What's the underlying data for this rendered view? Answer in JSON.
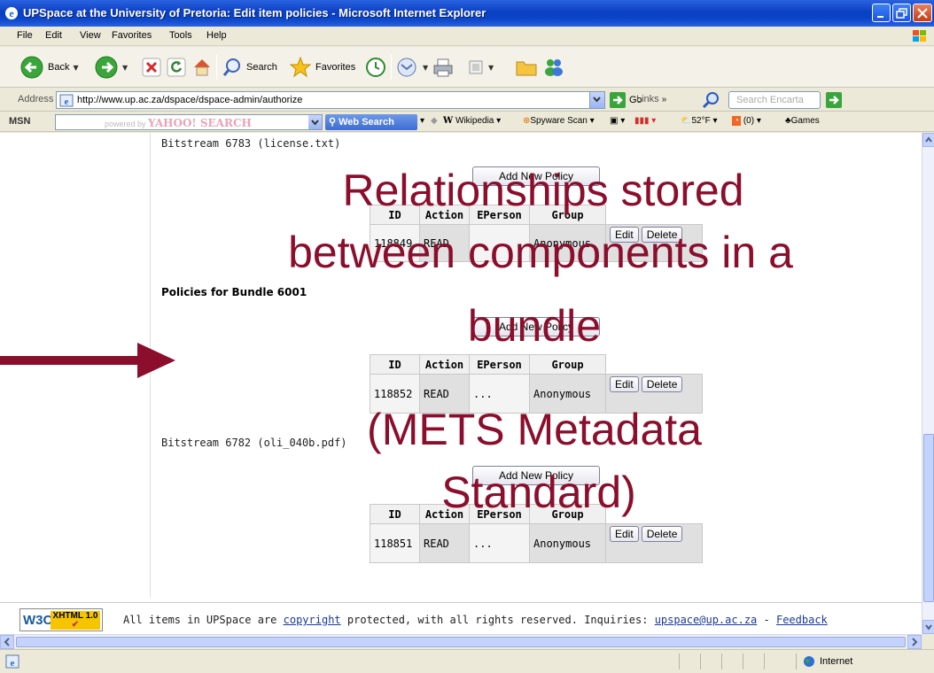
{
  "window": {
    "title": "UPSpace at the University of Pretoria: Edit item policies - Microsoft Internet Explorer"
  },
  "menu": [
    "File",
    "Edit",
    "View",
    "Favorites",
    "Tools",
    "Help"
  ],
  "toolbar": {
    "back": "Back",
    "search": "Search",
    "favorites": "Favorites"
  },
  "address": {
    "label": "Address",
    "url": "http://www.up.ac.za/dspace/dspace-admin/authorize",
    "go": "Go",
    "links": "Links",
    "encarta_placeholder": "Search Encarta"
  },
  "searchbar": {
    "msn": "MSN",
    "powered_by": "powered by",
    "yahoo": "YAHOO! SEARCH",
    "web_search": "Web Search",
    "wikipedia": "Wikipedia",
    "spyware": "Spyware Scan",
    "weather": "52°F",
    "rss": "(0)",
    "games": "Games"
  },
  "content": {
    "bitstream_license": "Bitstream 6783 (license.txt)",
    "policies_bundle": "Policies for Bundle 6001",
    "bitstream_pdf": "Bitstream 6782 (oli_040b.pdf)",
    "add_policy": "Add New Policy",
    "columns": [
      "ID",
      "Action",
      "EPerson",
      "Group"
    ],
    "edit": "Edit",
    "delete": "Delete",
    "rows": [
      {
        "id": "118849",
        "action": "READ",
        "eperson": "",
        "group": "Anonymous"
      },
      {
        "id": "118852",
        "action": "READ",
        "eperson": "...",
        "group": "Anonymous"
      },
      {
        "id": "118851",
        "action": "READ",
        "eperson": "...",
        "group": "Anonymous"
      }
    ]
  },
  "footer": {
    "w3c": "W3C",
    "xhtml": "XHTML 1.0",
    "text_1": "All items in UPSpace are",
    "copyright": "copyright",
    "text_2": "protected, with all rights reserved. Inquiries:",
    "email": "upspace@up.ac.za",
    "dash": "-",
    "feedback": "Feedback"
  },
  "status": {
    "zone": "Internet"
  },
  "overlay": {
    "line1": "Relationships stored",
    "line2": "between components in a",
    "line3": "bundle",
    "line4": "(METS Metadata",
    "line5": "Standard)",
    "color": "#8b0e2c"
  }
}
